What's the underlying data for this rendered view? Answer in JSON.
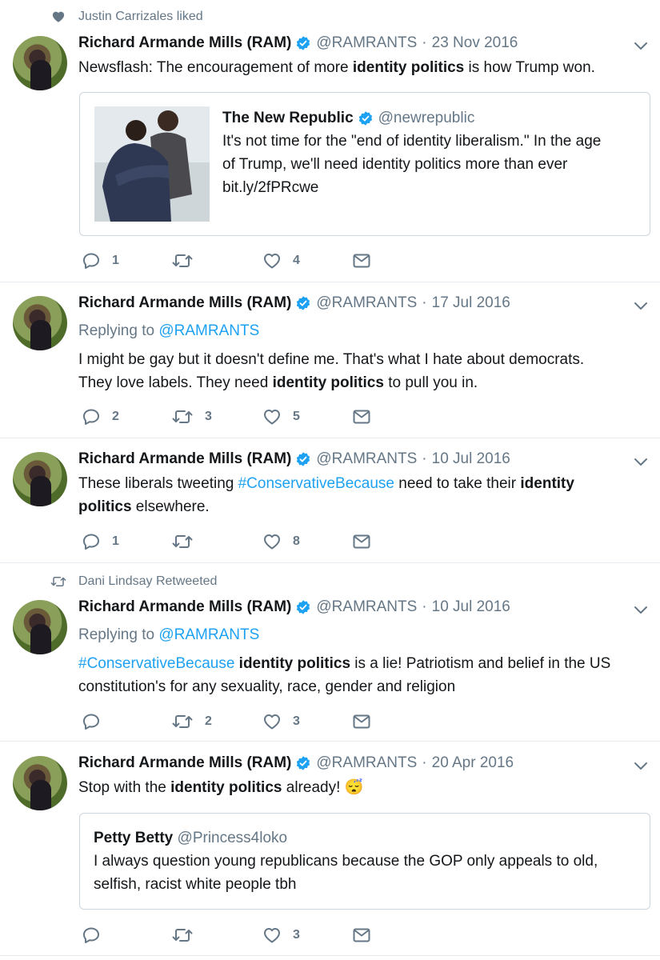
{
  "colors": {
    "accent": "#1da1f2",
    "muted": "#657786",
    "text": "#14171a",
    "border": "#e6ecf0",
    "verified": "#1da1f2",
    "heart_context": "#657786"
  },
  "tweets": [
    {
      "context": "Justin Carrizales liked",
      "context_icon": "heart-icon",
      "name": "Richard Armande Mills (RAM)",
      "handle": "@RAMRANTS",
      "dot": "·",
      "date": "23 Nov 2016",
      "text_before": "Newsflash: The encouragement of more ",
      "bold": "identity politics",
      "text_after": " is how Trump won.",
      "quote": {
        "name": "The New Republic",
        "handle": "@newrepublic",
        "line1": "It's not time for the \"end of identity liberalism.\" In the age",
        "line2": "of Trump, we'll need identity politics more than ever",
        "line3": "bit.ly/2fPRcwe"
      },
      "reply_count": "1",
      "retweet_count": "",
      "like_count": "4"
    },
    {
      "name": "Richard Armande Mills (RAM)",
      "handle": "@RAMRANTS",
      "dot": "·",
      "date": "17 Jul 2016",
      "replying_prefix": "Replying to ",
      "replying_to": "@RAMRANTS",
      "line1": "I might be gay but it doesn't define me. That's what I hate about democrats.",
      "line2_before": "They love labels. They need ",
      "bold": "identity politics",
      "line2_after": " to pull you in.",
      "reply_count": "2",
      "retweet_count": "3",
      "like_count": "5"
    },
    {
      "name": "Richard Armande Mills (RAM)",
      "handle": "@RAMRANTS",
      "dot": "·",
      "date": "10 Jul 2016",
      "line1_before": "These liberals tweeting ",
      "hashtag": "#ConservativeBecause",
      "line1_mid": " need to take their ",
      "bold1": "identity",
      "bold2": "politics",
      "line2_after": " elsewhere.",
      "reply_count": "1",
      "retweet_count": "",
      "like_count": "8"
    },
    {
      "context": "Dani Lindsay Retweeted",
      "context_icon": "retweet-icon",
      "name": "Richard Armande Mills (RAM)",
      "handle": "@RAMRANTS",
      "dot": "·",
      "date": "10 Jul 2016",
      "replying_prefix": "Replying to ",
      "replying_to": "@RAMRANTS",
      "hashtag": "#ConservativeBecause",
      "bold": "identity politics",
      "line1_after": " is a lie! Patriotism and belief in the US",
      "line2": "constitution's for any sexuality, race, gender and religion",
      "reply_count": "",
      "retweet_count": "2",
      "like_count": "3"
    },
    {
      "name": "Richard Armande Mills (RAM)",
      "handle": "@RAMRANTS",
      "dot": "·",
      "date": "20 Apr 2016",
      "text_before": "Stop with the ",
      "bold": "identity politics",
      "text_after": " already! ",
      "emoji": "😴",
      "quote": {
        "name": "Petty Betty",
        "handle": "@Princess4loko",
        "line1": "I always question young republicans because the GOP only appeals to old,",
        "line2": "selfish, racist white people tbh"
      },
      "reply_count": "",
      "retweet_count": "",
      "like_count": "3"
    }
  ]
}
